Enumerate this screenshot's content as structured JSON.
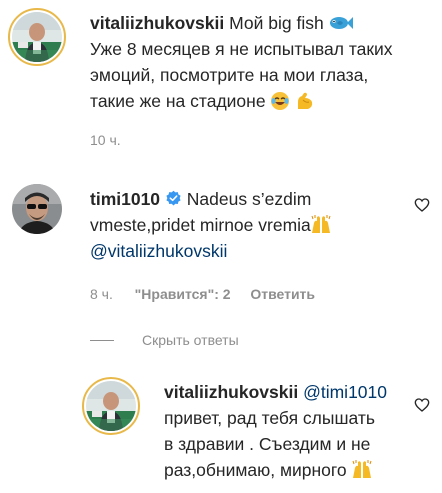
{
  "comment1": {
    "username": "vitaliizhukovskii",
    "line1_text": "Мой big fish",
    "line1_emoji": "fish-emoji",
    "line2": "Уже 8 месяцев я не испытывал таких",
    "line3": "эмоций, посмотрите на мои глаза,",
    "line4_text": "такие же на стадионе",
    "line4_emojis": [
      "crying-laughing-emoji",
      "flexed-biceps-emoji"
    ],
    "time": "10 ч."
  },
  "comment2": {
    "username": "timi1010",
    "verified_icon": "verified-badge-icon",
    "line1_text": "Nadeus s’ezdim",
    "line2_text": "vmeste,pridet mirnoe vremia",
    "line2_emoji": "raising-hands-emoji",
    "mention": "@vitaliizhukovskii",
    "time": "8 ч.",
    "likes": "\"Нравится\": 2",
    "reply_label": "Ответить"
  },
  "replies_toggle": {
    "label": "Скрыть ответы"
  },
  "reply1": {
    "username": "vitaliizhukovskii",
    "mention": "@timi1010",
    "line2": "привет, рад тебя слышать",
    "line3": "в здравии . Съездим и не",
    "line4_text": "раз,обнимаю, мирного",
    "line4_emoji": "raising-hands-emoji"
  },
  "colors": {
    "text": "#262626",
    "meta": "#8e8e8e",
    "link": "#00376b",
    "verified": "#3897f0",
    "avatar_ring": "#e8b94a"
  }
}
